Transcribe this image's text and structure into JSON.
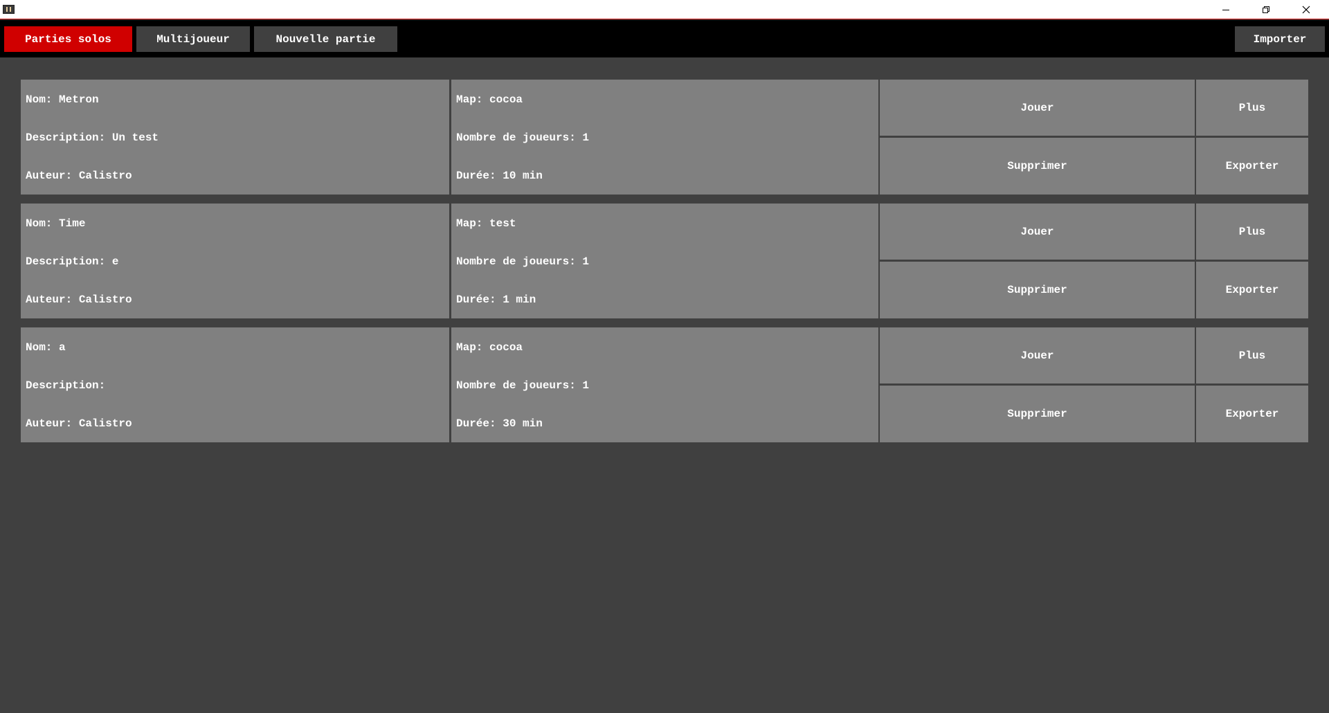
{
  "window": {
    "controls": {
      "minimize_icon": "minimize-icon",
      "maximize_icon": "restore-icon",
      "close_icon": "close-icon"
    }
  },
  "toolbar": {
    "tabs": [
      {
        "label": "Parties solos",
        "active": true
      },
      {
        "label": "Multijoueur",
        "active": false
      },
      {
        "label": "Nouvelle partie",
        "active": false
      }
    ],
    "import_label": "Importer"
  },
  "games": [
    {
      "name": "Nom: Metron",
      "description": "Description: Un test",
      "author": "Auteur: Calistro",
      "map": "Map: cocoa",
      "players": "Nombre de joueurs: 1",
      "duration": "Durée: 10 min"
    },
    {
      "name": "Nom: Time",
      "description": "Description: e",
      "author": "Auteur: Calistro",
      "map": "Map: test",
      "players": "Nombre de joueurs: 1",
      "duration": "Durée: 1 min"
    },
    {
      "name": "Nom: a",
      "description": "Description:",
      "author": "Auteur: Calistro",
      "map": "Map: cocoa",
      "players": "Nombre de joueurs: 1",
      "duration": "Durée: 30 min"
    }
  ],
  "actions": {
    "play": "Jouer",
    "more": "Plus",
    "delete": "Supprimer",
    "export": "Exporter"
  },
  "colors": {
    "background": "#404040",
    "toolbar": "#000000",
    "active_tab": "#d00000",
    "card": "#808080"
  }
}
